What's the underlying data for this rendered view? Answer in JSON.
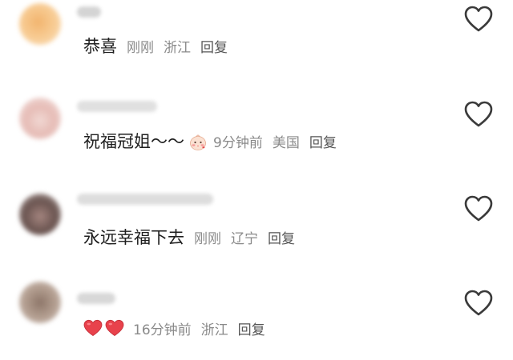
{
  "comments": [
    {
      "text": "恭喜",
      "time": "刚刚",
      "location": "浙江",
      "reply_label": "回复"
    },
    {
      "text": "祝福冠姐～～",
      "emoji": "blushing-face-emoji",
      "time": "9分钟前",
      "location": "美国",
      "reply_label": "回复"
    },
    {
      "text": "永远幸福下去",
      "time": "刚刚",
      "location": "辽宁",
      "reply_label": "回复"
    },
    {
      "emojis": [
        "red-heart-emoji",
        "red-heart-emoji"
      ],
      "time": "16分钟前",
      "location": "浙江",
      "reply_label": "回复"
    }
  ],
  "icons": {
    "like": "heart-outline-icon"
  },
  "colors": {
    "text": "#1f1f1f",
    "meta": "#8a8a8a",
    "heart": "#e8424c",
    "icon": "#3a3a3a"
  }
}
